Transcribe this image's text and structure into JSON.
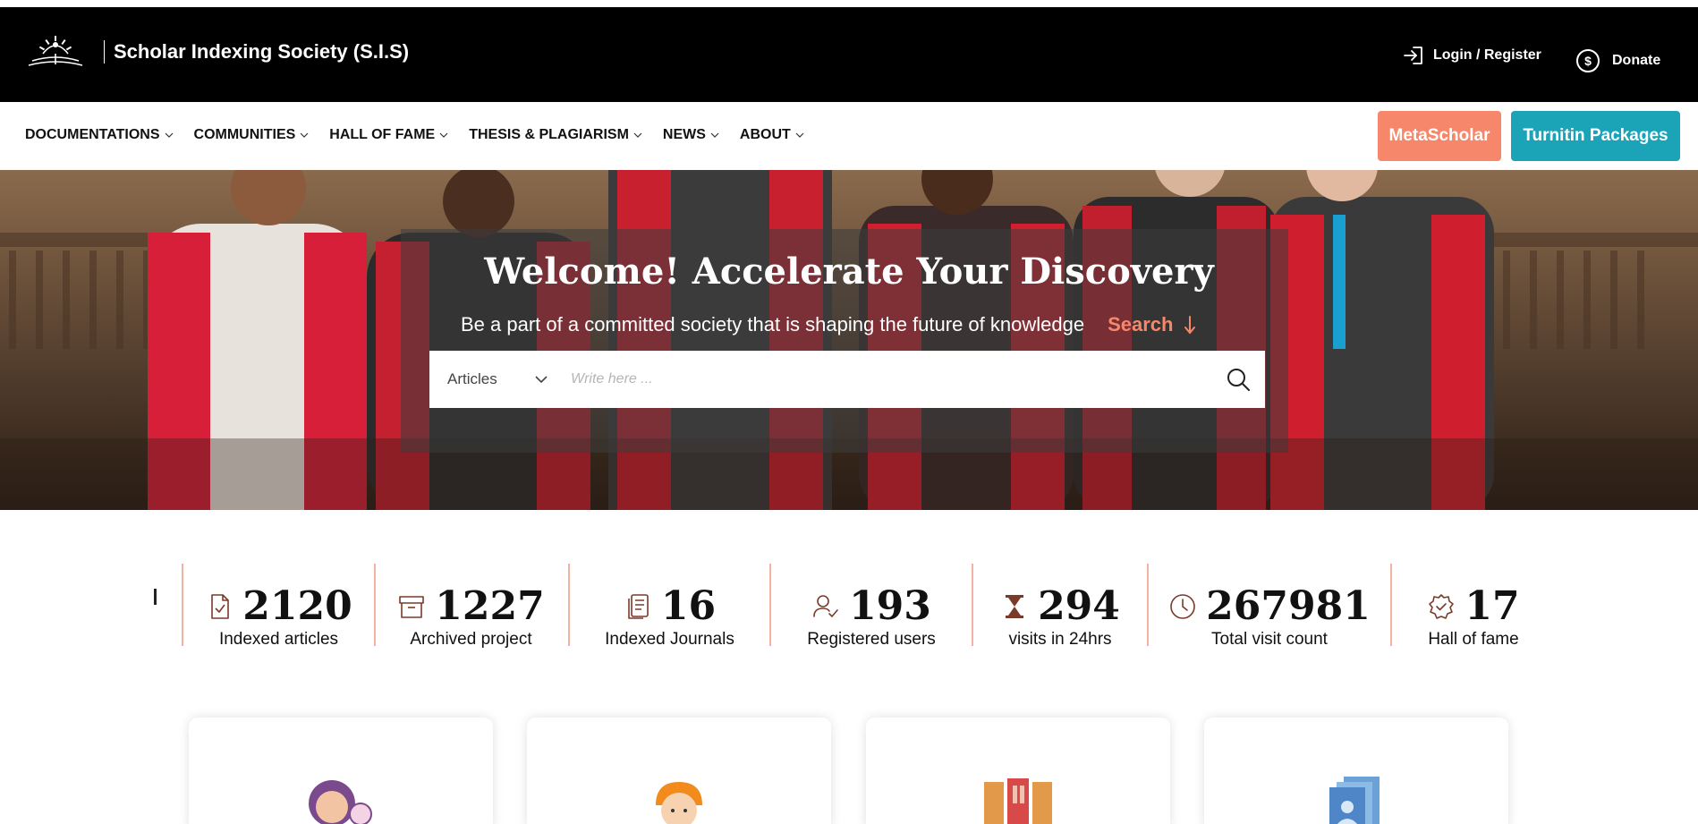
{
  "header": {
    "site_name": "Scholar Indexing Society (S.I.S)",
    "login_label": "Login / Register",
    "donate_label": "Donate",
    "donate_symbol": "$"
  },
  "nav": {
    "items": [
      {
        "label": "DOCUMENTATIONS"
      },
      {
        "label": "COMMUNITIES"
      },
      {
        "label": "HALL OF FAME"
      },
      {
        "label": "THESIS & PLAGIARISM"
      },
      {
        "label": "NEWS"
      },
      {
        "label": "ABOUT"
      }
    ],
    "metascholar_label": "MetaScholar",
    "turnitin_label": "Turnitin Packages"
  },
  "hero": {
    "title": "Welcome! Accelerate Your Discovery",
    "subtitle": "Be a part of a committed society that is shaping the future of knowledge",
    "search_link": "Search",
    "search": {
      "category": "Articles",
      "placeholder": "Write here ..."
    }
  },
  "stats": [
    {
      "icon": "file-check-icon",
      "value": "2120",
      "label": "Indexed articles"
    },
    {
      "icon": "archive-box-icon",
      "value": "1227",
      "label": "Archived project"
    },
    {
      "icon": "notebook-stack-icon",
      "value": "16",
      "label": "Indexed Journals"
    },
    {
      "icon": "user-check-icon",
      "value": "193",
      "label": "Registered users"
    },
    {
      "icon": "hourglass-icon",
      "value": "294",
      "label": "visits in 24hrs"
    },
    {
      "icon": "clock-icon",
      "value": "267981",
      "label": "Total visit count"
    },
    {
      "icon": "badge-check-icon",
      "value": "17",
      "label": "Hall of fame"
    }
  ],
  "cards": [
    {
      "icon": "woman-avatar-icon"
    },
    {
      "icon": "man-avatar-icon"
    },
    {
      "icon": "books-icon"
    },
    {
      "icon": "profile-document-icon"
    }
  ],
  "colors": {
    "header_bg": "#000000",
    "accent_orange": "#f7876a",
    "accent_teal": "#1ba4b7",
    "icon_brown": "#7a3a2a",
    "divider": "#f2b3a2"
  }
}
